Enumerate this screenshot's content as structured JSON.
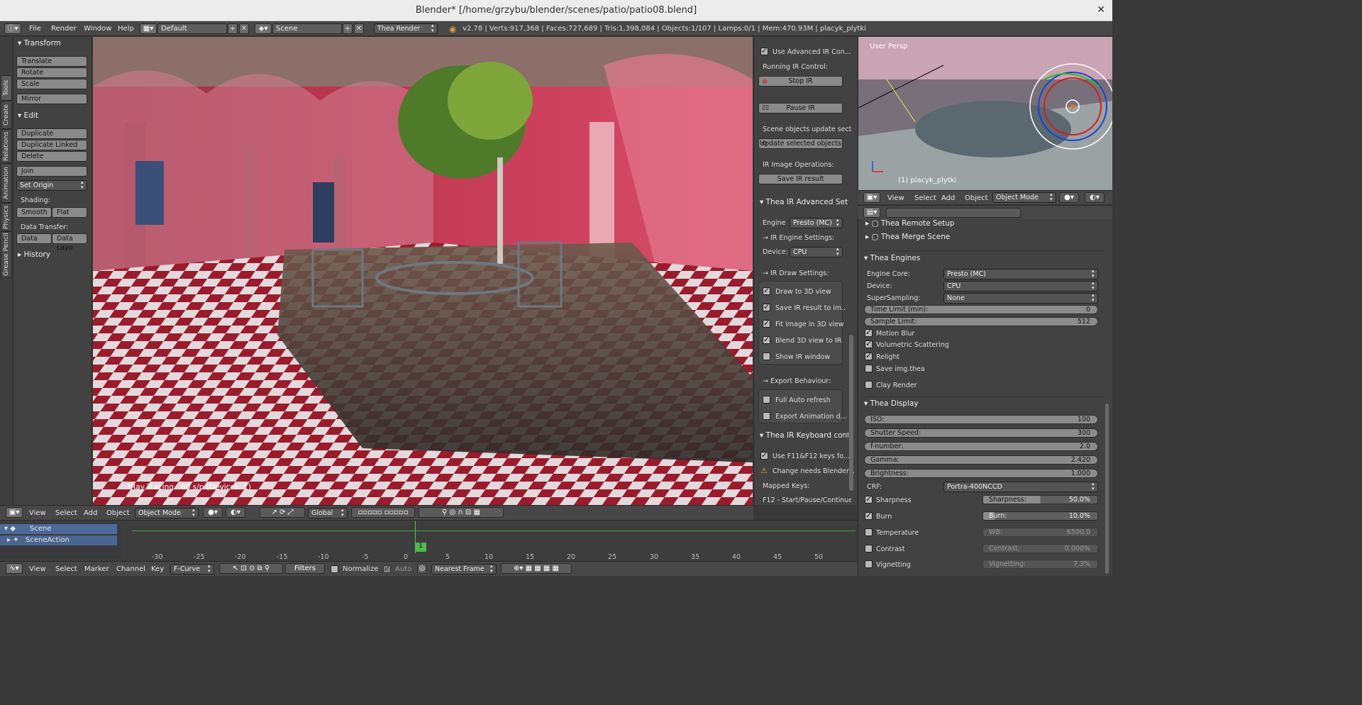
{
  "window": {
    "title": "Blender* [/home/grzybu/blender/scenes/patio/patio08.blend]",
    "close": "✕"
  },
  "menu": {
    "items": [
      "File",
      "Render",
      "Window",
      "Help"
    ],
    "layout": "Default",
    "scene": "Scene",
    "engine": "Thea Render",
    "stats": "v2.78 | Verts:917,368 | Faces:727,689 | Tris:1,398,084 | Objects:1/107 | Lamps:0/1 | Mem:470.93M | placyk_plytki"
  },
  "tabs": [
    "Tools",
    "Create",
    "Relations",
    "Animation",
    "Physics",
    "Grease Pencil"
  ],
  "toolshelf": {
    "transform": "Transform",
    "translate": "Translate",
    "rotate": "Rotate",
    "scale": "Scale",
    "mirror": "Mirror",
    "edit": "Edit",
    "duplicate": "Duplicate",
    "duplicate_linked": "Duplicate Linked",
    "delete": "Delete",
    "join": "Join",
    "set_origin": "Set Origin",
    "shading": "Shading:",
    "smooth": "Smooth",
    "flat": "Flat",
    "data_transfer": "Data Transfer:",
    "data": "Data",
    "data_layo": "Data Layo",
    "history": "History"
  },
  "viewport": {
    "status": "!Ray Tracing : 60 s/p (Devices: 1)"
  },
  "npanel": {
    "use_adv": "Use Advanced IR Con...",
    "running": "Running IR Control:",
    "stop": "Stop IR",
    "pause": "Pause IR",
    "scene_upd": "Scene objects update sect...",
    "update_sel": "Update selected objects",
    "image_ops": "IR Image Operations:",
    "save_ir": "Save IR result",
    "adv_settings": "Thea IR Advanced Settin",
    "engine_label": "Engine",
    "engine_val": "Presto (MC)",
    "ir_engine": "IR Engine Settings:",
    "device_label": "Device:",
    "device_val": "CPU",
    "draw_settings": "IR Draw Settings:",
    "draw3d": "Draw to 3D view",
    "save_result": "Save IR result to im...",
    "fit_image": "Fit image in 3D view",
    "blend3d": "Blend 3D view to IR",
    "show_ir": "Show IR window",
    "export_beh": "Export Behaviour:",
    "full_auto": "Full Auto refresh",
    "export_anim": "Export Animation d...",
    "kb_control": "Thea IR Keyboard contro",
    "use_f11": "Use F11&F12 keys fo...",
    "change_needs": "Change needs Blender...",
    "mapped": "Mapped Keys:",
    "f12": "F12 - Start/Pause/Continue"
  },
  "view3d": {
    "persp": "User Persp",
    "obj": "(1) placyk_plytki",
    "view": "View",
    "select": "Select",
    "add": "Add",
    "object": "Object",
    "mode": "Object Mode"
  },
  "props": {
    "remote": "Thea Remote Setup",
    "merge": "Thea Merge Scene",
    "engines": "Thea Engines",
    "core_l": "Engine Core:",
    "core_v": "Presto (MC)",
    "device_l": "Device:",
    "device_v": "CPU",
    "ss_l": "SuperSampling:",
    "ss_v": "None",
    "time_l": "Time Limit (min):",
    "time_v": "0",
    "sample_l": "Sample Limit:",
    "sample_v": "512",
    "motion": "Motion Blur",
    "volumetric": "Volumetric Scattering",
    "relight": "Relight",
    "save_img": "Save img.thea",
    "clay": "Clay Render",
    "display": "Thea Display",
    "iso_l": "ISO:",
    "iso_v": "100",
    "shutter_l": "Shutter Speed:",
    "shutter_v": "300",
    "fnum_l": "f-number:",
    "fnum_v": "2.0",
    "gamma_l": "Gamma:",
    "gamma_v": "2.420",
    "bright_l": "Brightness:",
    "bright_v": "1.000",
    "crf_l": "CRF:",
    "crf_v": "Portra-400NCCD",
    "sharp": "Sharpness",
    "sharp_l": "Sharpness:",
    "sharp_v": "50.0%",
    "burn": "Burn",
    "burn_l": "Burn:",
    "burn_v": "10.0%",
    "temp": "Temperature",
    "wb_l": "WB:",
    "wb_v": "6500.0",
    "contrast": "Contrast",
    "contrast_l": "Contrast:",
    "contrast_v": "0.000%",
    "vignet": "Vignetting",
    "vignet_l": "Vignetting:",
    "vignet_v": "7.3%"
  },
  "bottom": {
    "view": "View",
    "select": "Select",
    "add": "Add",
    "object": "Object",
    "mode": "Object Mode",
    "global": "Global",
    "scene": "Scene",
    "action": "SceneAction",
    "frame": "1",
    "ticks": [
      "-30",
      "-25",
      "-20",
      "-15",
      "-10",
      "-5",
      "0",
      "5",
      "10",
      "15",
      "20",
      "25",
      "30",
      "35",
      "40",
      "45",
      "50"
    ],
    "marker": "Marker",
    "channel": "Channel",
    "key": "Key",
    "fcurve": "F-Curve",
    "filters": "Filters",
    "normalize": "Normalize",
    "auto": "Auto",
    "nearest": "Nearest Frame"
  }
}
